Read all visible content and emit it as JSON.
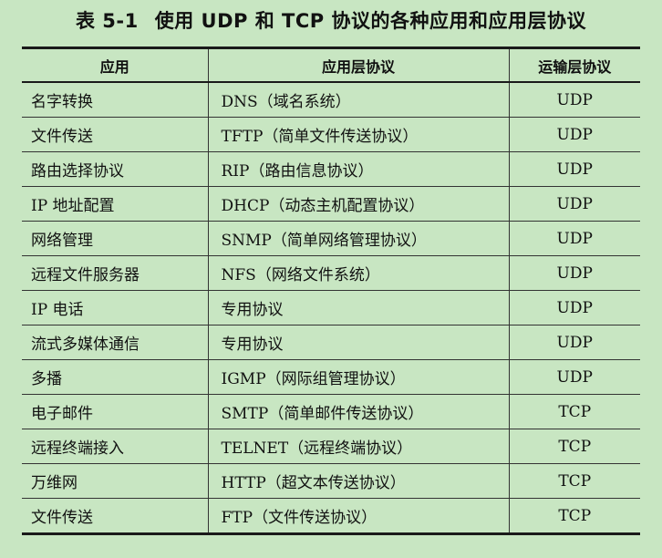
{
  "caption": {
    "number": "表 5-1",
    "title": "使用 UDP 和 TCP 协议的各种应用和应用层协议"
  },
  "table": {
    "headers": [
      "应用",
      "应用层协议",
      "运输层协议"
    ],
    "rows": [
      {
        "app": "名字转换",
        "protocol": "DNS（域名系统）",
        "transport": "UDP"
      },
      {
        "app": "文件传送",
        "protocol": "TFTP（简单文件传送协议）",
        "transport": "UDP"
      },
      {
        "app": "路由选择协议",
        "protocol": "RIP（路由信息协议）",
        "transport": "UDP"
      },
      {
        "app": "IP 地址配置",
        "protocol": "DHCP（动态主机配置协议）",
        "transport": "UDP"
      },
      {
        "app": "网络管理",
        "protocol": "SNMP（简单网络管理协议）",
        "transport": "UDP"
      },
      {
        "app": "远程文件服务器",
        "protocol": "NFS（网络文件系统）",
        "transport": "UDP"
      },
      {
        "app": "IP 电话",
        "protocol": "专用协议",
        "transport": "UDP"
      },
      {
        "app": "流式多媒体通信",
        "protocol": "专用协议",
        "transport": "UDP"
      },
      {
        "app": "多播",
        "protocol": "IGMP（网际组管理协议）",
        "transport": "UDP"
      },
      {
        "app": "电子邮件",
        "protocol": "SMTP（简单邮件传送协议）",
        "transport": "TCP"
      },
      {
        "app": "远程终端接入",
        "protocol": "TELNET（远程终端协议）",
        "transport": "TCP"
      },
      {
        "app": "万维网",
        "protocol": "HTTP（超文本传送协议）",
        "transport": "TCP"
      },
      {
        "app": "文件传送",
        "protocol": "FTP（文件传送协议）",
        "transport": "TCP"
      }
    ]
  },
  "colors": {
    "background": "#c8e6c2",
    "text": "#111111",
    "rule": "#1a1a1a"
  }
}
